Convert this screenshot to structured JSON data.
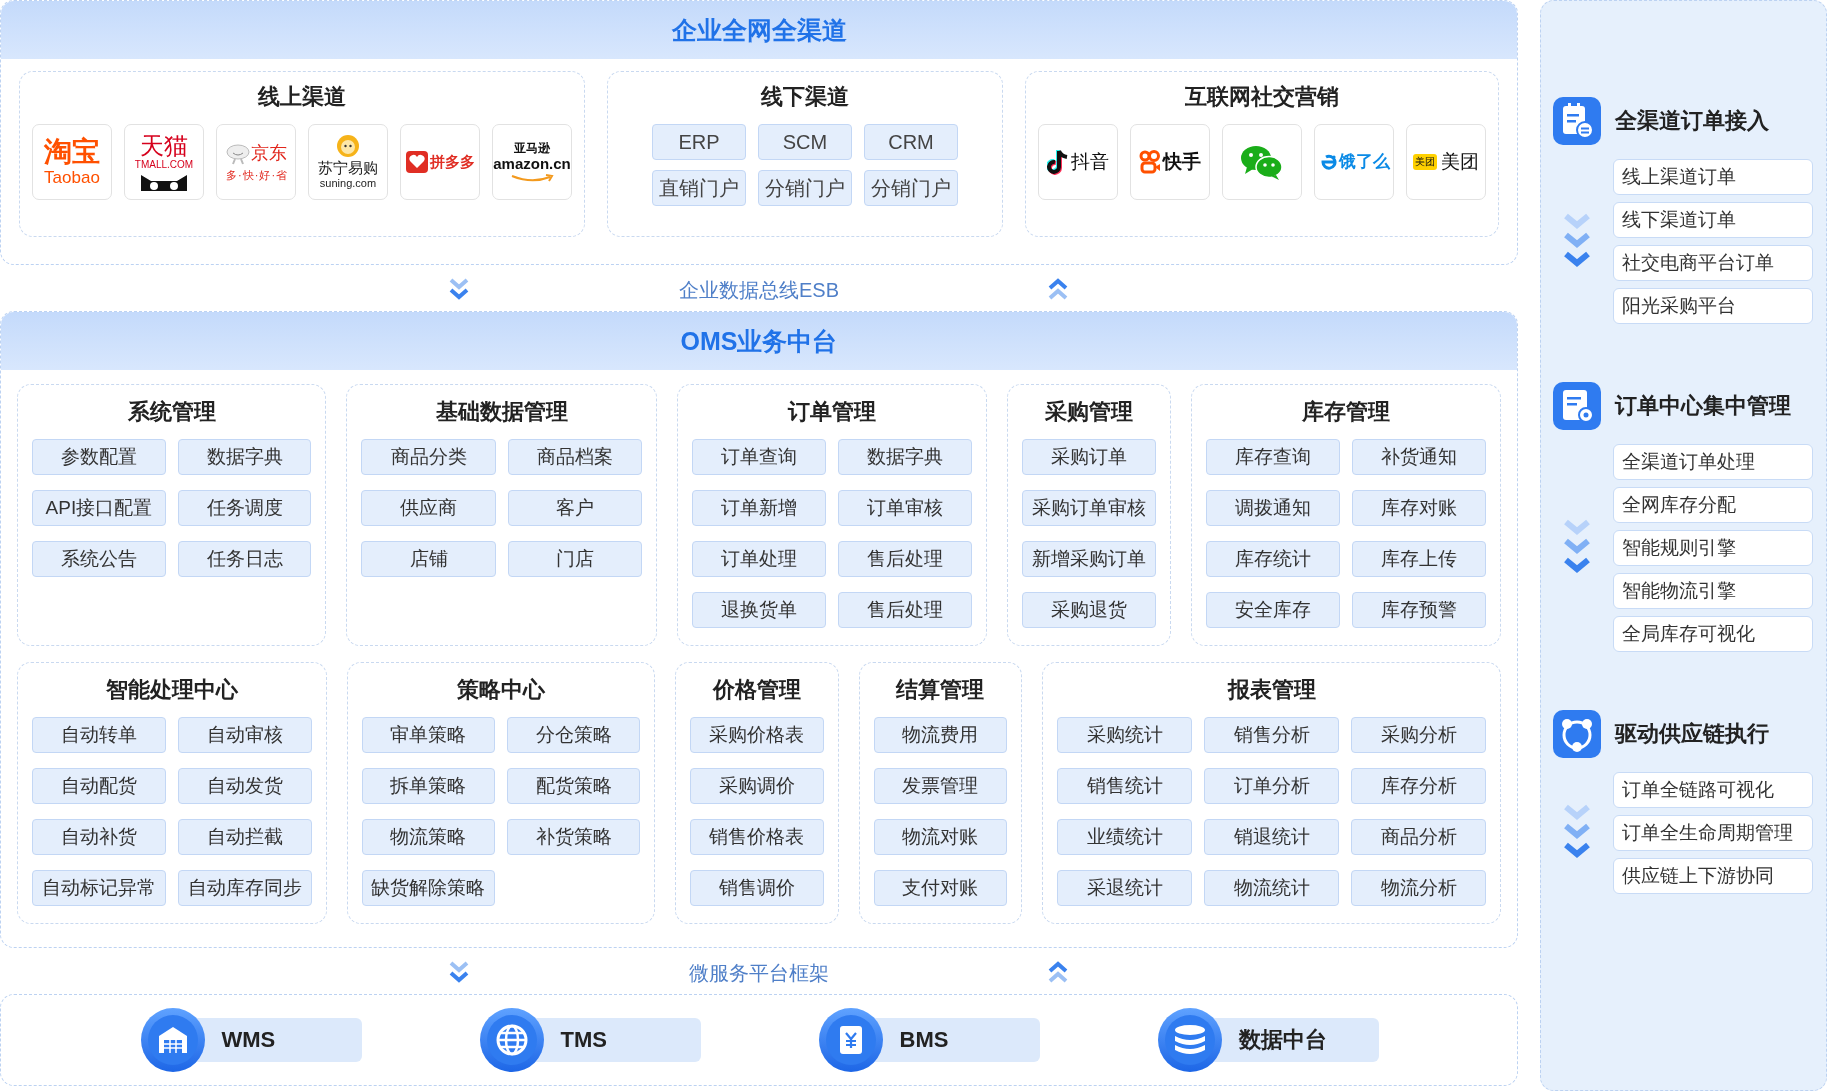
{
  "header": {
    "title": "企业全网全渠道"
  },
  "channels": [
    {
      "title": "线上渠道",
      "kind": "logos",
      "logos": [
        {
          "kind": "taobao",
          "name": "淘宝",
          "sub": "Taobao"
        },
        {
          "kind": "tmall",
          "name": "天猫",
          "sub": "TMALL.COM"
        },
        {
          "kind": "jd",
          "name": "京东",
          "sub": "多 · 快 · 好 · 省"
        },
        {
          "kind": "suning",
          "name": "苏宁易购",
          "sub": "suning.com"
        },
        {
          "kind": "pdd",
          "name": "拼多多"
        },
        {
          "kind": "amazon",
          "name": "亚马逊",
          "sub": "amazon.cn"
        }
      ]
    },
    {
      "title": "线下渠道",
      "kind": "chips",
      "items": [
        "ERP",
        "SCM",
        "CRM",
        "直销门户",
        "分销门户",
        "分销门户"
      ]
    },
    {
      "title": "互联网社交营销",
      "kind": "logos",
      "logos": [
        {
          "kind": "douyin",
          "name": "抖音"
        },
        {
          "kind": "kuaishou",
          "name": "快手"
        },
        {
          "kind": "wechat"
        },
        {
          "kind": "eleme",
          "name": "饿了么"
        },
        {
          "kind": "meituan",
          "badge": "美团",
          "name": "美团"
        }
      ]
    }
  ],
  "bus_label": "企业数据总线ESB",
  "platform": {
    "title": "OMS业务中台",
    "module_rows": [
      [
        {
          "title": "系统管理",
          "items": [
            "参数配置",
            "数据字典",
            "API接口配置",
            "任务调度",
            "系统公告",
            "任务日志"
          ]
        },
        {
          "title": "基础数据管理",
          "items": [
            "商品分类",
            "商品档案",
            "供应商",
            "客户",
            "店铺",
            "门店"
          ]
        },
        {
          "title": "订单管理",
          "items": [
            "订单查询",
            "数据字典",
            "订单新增",
            "订单审核",
            "订单处理",
            "售后处理",
            "退换货单",
            "售后处理"
          ]
        },
        {
          "title": "采购管理",
          "items": [
            "采购订单",
            "采购订单审核",
            "新增采购订单",
            "采购退货"
          ]
        },
        {
          "title": "库存管理",
          "items": [
            "库存查询",
            "补货通知",
            "调拨通知",
            "库存对账",
            "库存统计",
            "库存上传",
            "安全库存",
            "库存预警"
          ]
        }
      ],
      [
        {
          "title": "智能处理中心",
          "items": [
            "自动转单",
            "自动审核",
            "自动配货",
            "自动发货",
            "自动补货",
            "自动拦截",
            "自动标记异常",
            "自动库存同步"
          ]
        },
        {
          "title": "策略中心",
          "items": [
            "审单策略",
            "分仓策略",
            "拆单策略",
            "配货策略",
            "物流策略",
            "补货策略",
            "缺货解除策略"
          ]
        },
        {
          "title": "价格管理",
          "items": [
            "采购价格表",
            "采购调价",
            "销售价格表",
            "销售调价"
          ]
        },
        {
          "title": "结算管理",
          "items": [
            "物流费用",
            "发票管理",
            "物流对账",
            "支付对账"
          ]
        },
        {
          "title": "报表管理",
          "items": [
            "采购统计",
            "销售分析",
            "采购分析",
            "销售统计",
            "订单分析",
            "库存分析",
            "业绩统计",
            "销退统计",
            "商品分析",
            "采退统计",
            "物流统计",
            "物流分析"
          ]
        }
      ]
    ]
  },
  "framework_label": "微服务平台框架",
  "systems": [
    {
      "kind": "warehouse",
      "name": "WMS"
    },
    {
      "kind": "globe",
      "name": "TMS"
    },
    {
      "kind": "invoice",
      "name": "BMS"
    },
    {
      "kind": "database",
      "name": "数据中台"
    }
  ],
  "side_sections": [
    {
      "kind": "intake",
      "title": "全渠道订单接入",
      "items": [
        "线上渠道订单",
        "线下渠道订单",
        "社交电商平台订单",
        "阳光采购平台"
      ]
    },
    {
      "kind": "center",
      "title": "订单中心集中管理",
      "items": [
        "全渠道订单处理",
        "全网库存分配",
        "智能规则引擎",
        "智能物流引擎",
        "全局库存可视化"
      ]
    },
    {
      "kind": "supply",
      "title": "驱动供应链执行",
      "items": [
        "订单全链路可视化",
        "订单全生命周期管理",
        "供应链上下游协同"
      ]
    }
  ]
}
